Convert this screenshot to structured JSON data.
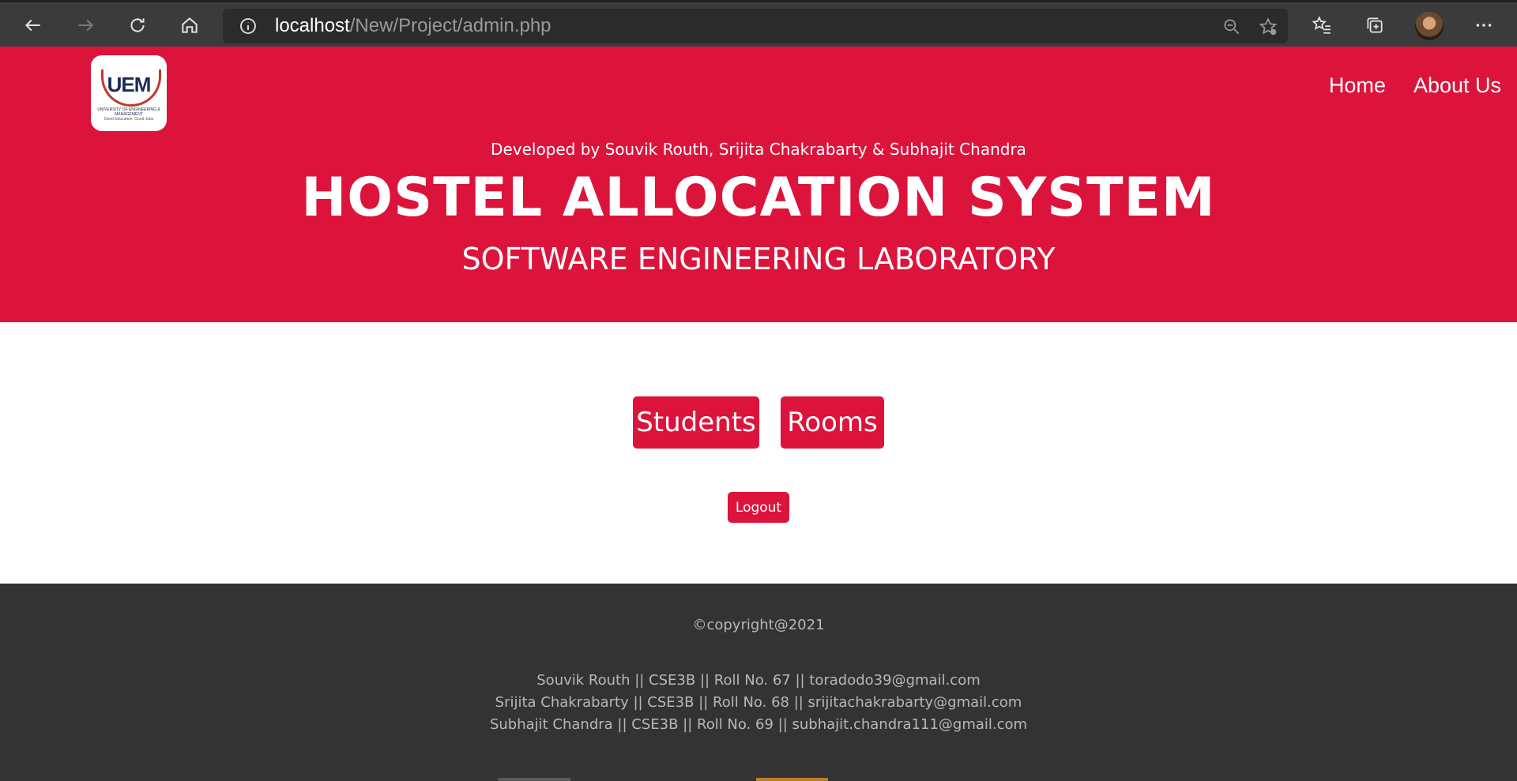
{
  "browser": {
    "url_host": "localhost",
    "url_path": "/New/Project/admin.php"
  },
  "header": {
    "logo_text": "UEM",
    "logo_caption": "UNIVERSITY OF ENGINEERING & MANAGEMENT",
    "logo_tagline": "Good Education, Good Jobs",
    "nav": [
      {
        "label": "Home"
      },
      {
        "label": "About Us"
      }
    ],
    "credits": "Developed by Souvik Routh, Srijita Chakrabarty & Subhajit Chandra",
    "title": "HOSTEL ALLOCATION SYSTEM",
    "subtitle": "SOFTWARE ENGINEERING LABORATORY"
  },
  "main": {
    "students_label": "Students",
    "rooms_label": "Rooms",
    "logout_label": "Logout"
  },
  "footer": {
    "copyright": "©copyright@2021",
    "members": [
      "Souvik Routh || CSE3B || Roll No. 67 || toradodo39@gmail.com",
      "Srijita Chakrabarty || CSE3B || Roll No. 68 || srijitachakrabarty@gmail.com",
      "Subhajit Chandra || CSE3B || Roll No. 69 || subhajit.chandra111@gmail.com"
    ]
  },
  "colors": {
    "brand": "#dc143c",
    "footer_bg": "#333333",
    "browser_bg": "#3b3b3b"
  }
}
